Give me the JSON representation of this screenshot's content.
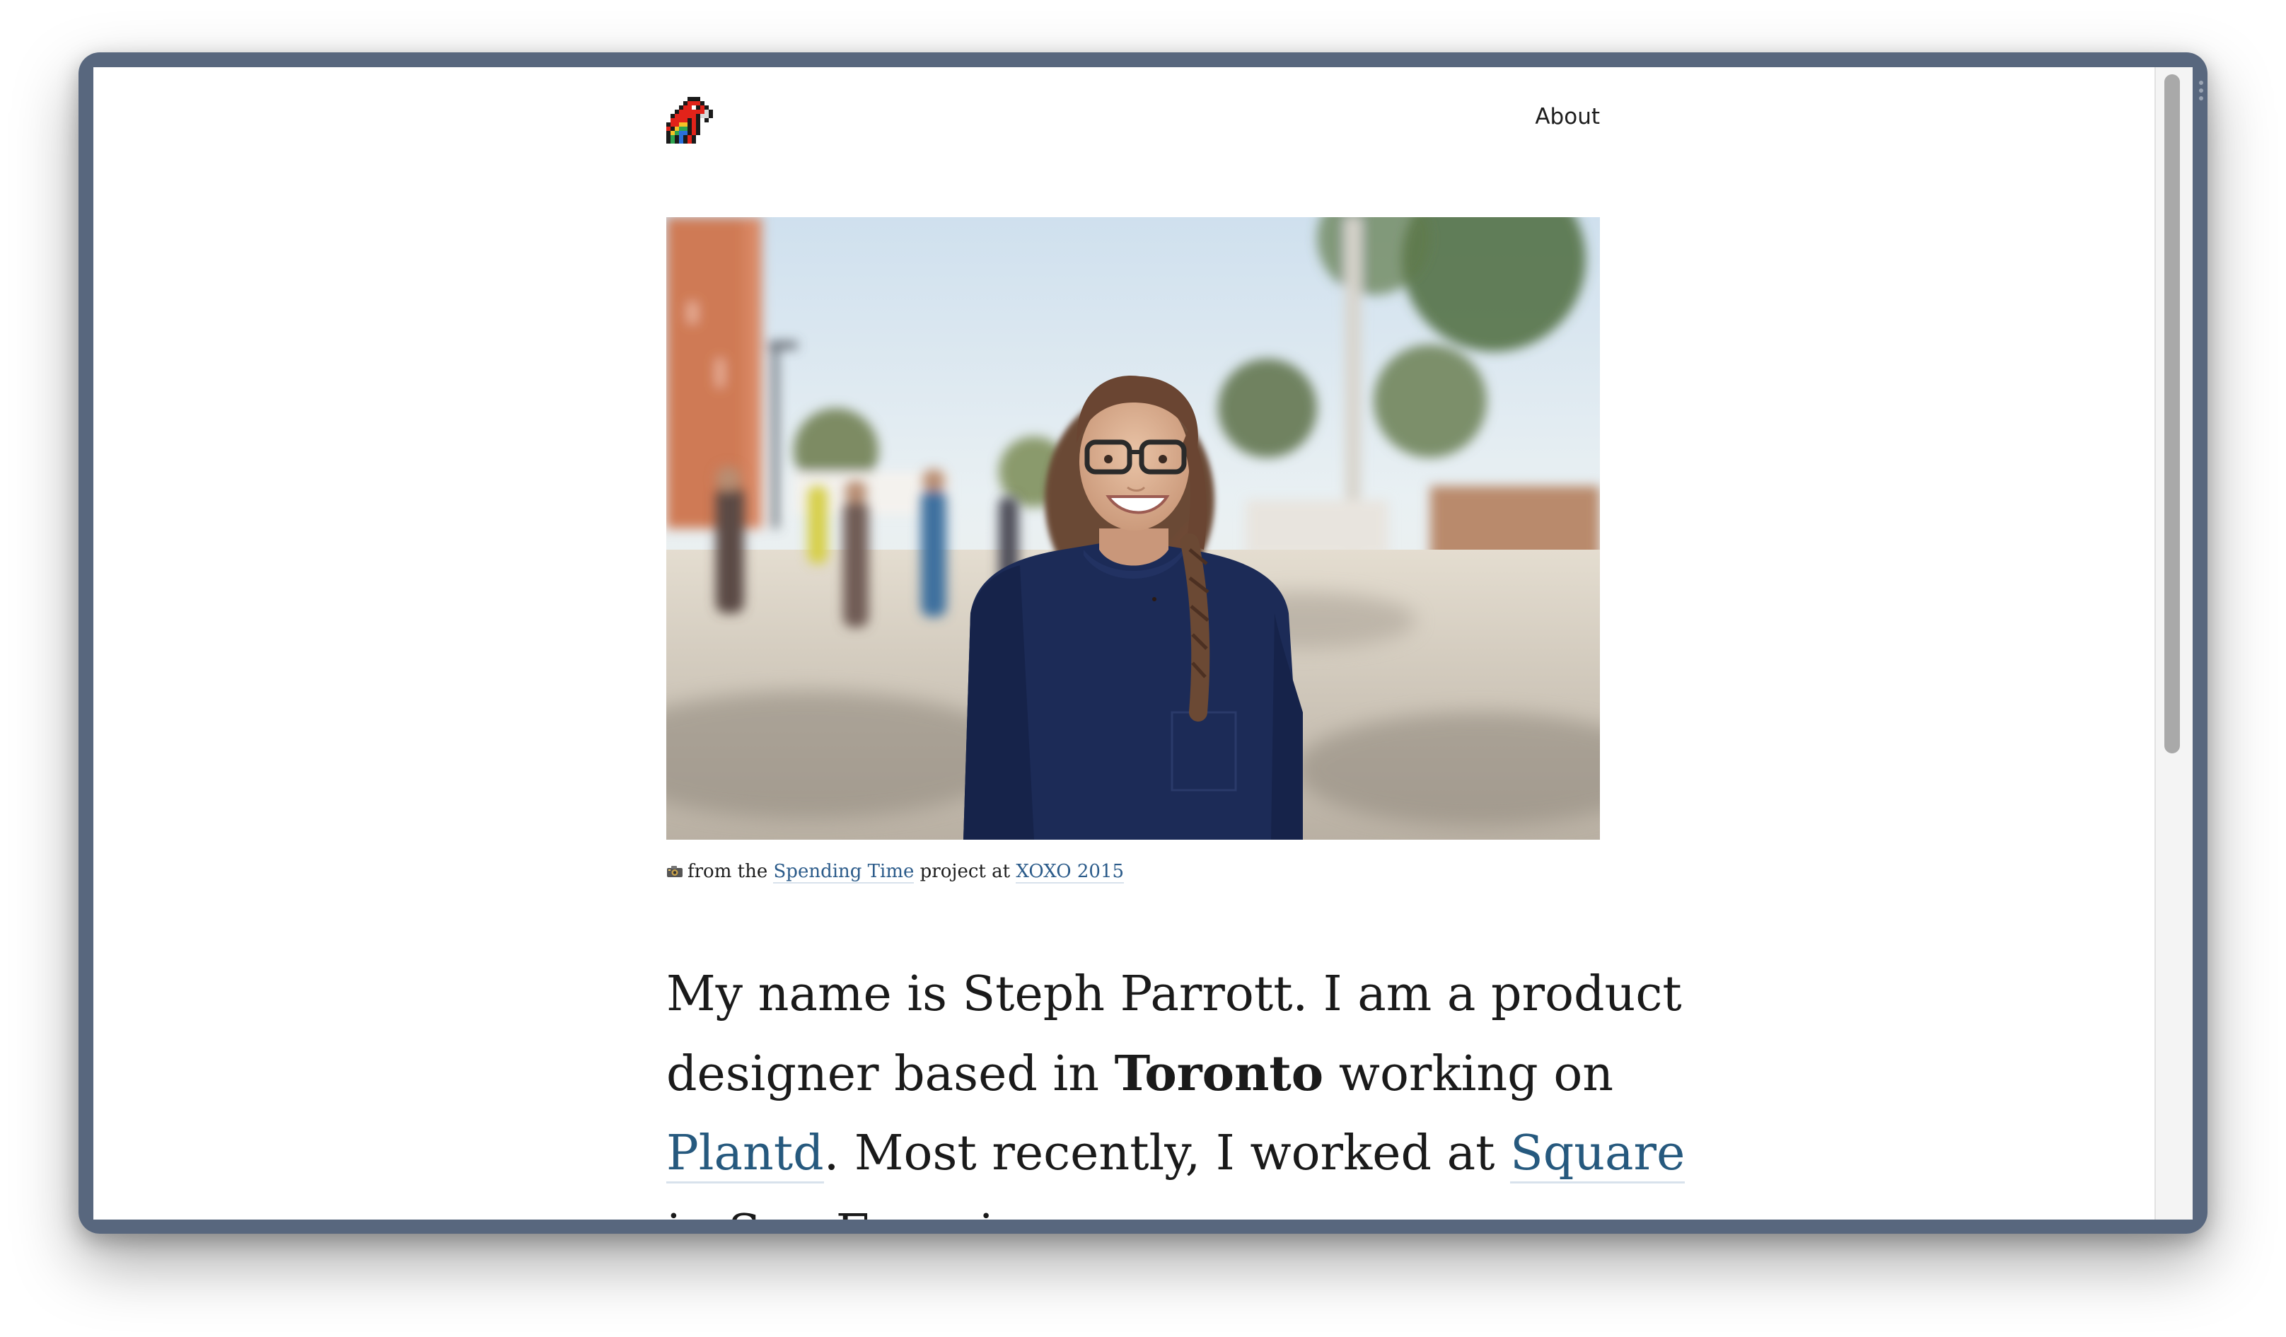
{
  "nav": {
    "about": "About"
  },
  "hero": {
    "alt": "Smiling woman with glasses and a braid wearing a navy t-shirt outdoors"
  },
  "caption": {
    "icon": "camera-icon",
    "before": "from the",
    "link1": "Spending Time",
    "middle": "project at",
    "link2": "XOXO 2015"
  },
  "intro": {
    "line1": "My name is Steph Parrott. I am a product",
    "line2_before": "designer based in ",
    "line2_bold": "Toronto",
    "line2_after": " working on",
    "line3_link1": "Plantd",
    "line3_middle": ". Most recently, I worked at ",
    "line3_link2": "Square",
    "line4": "in San Francisco."
  },
  "colors": {
    "frame": "#58677e",
    "link": "#26597e",
    "text": "#1a1a1a"
  }
}
